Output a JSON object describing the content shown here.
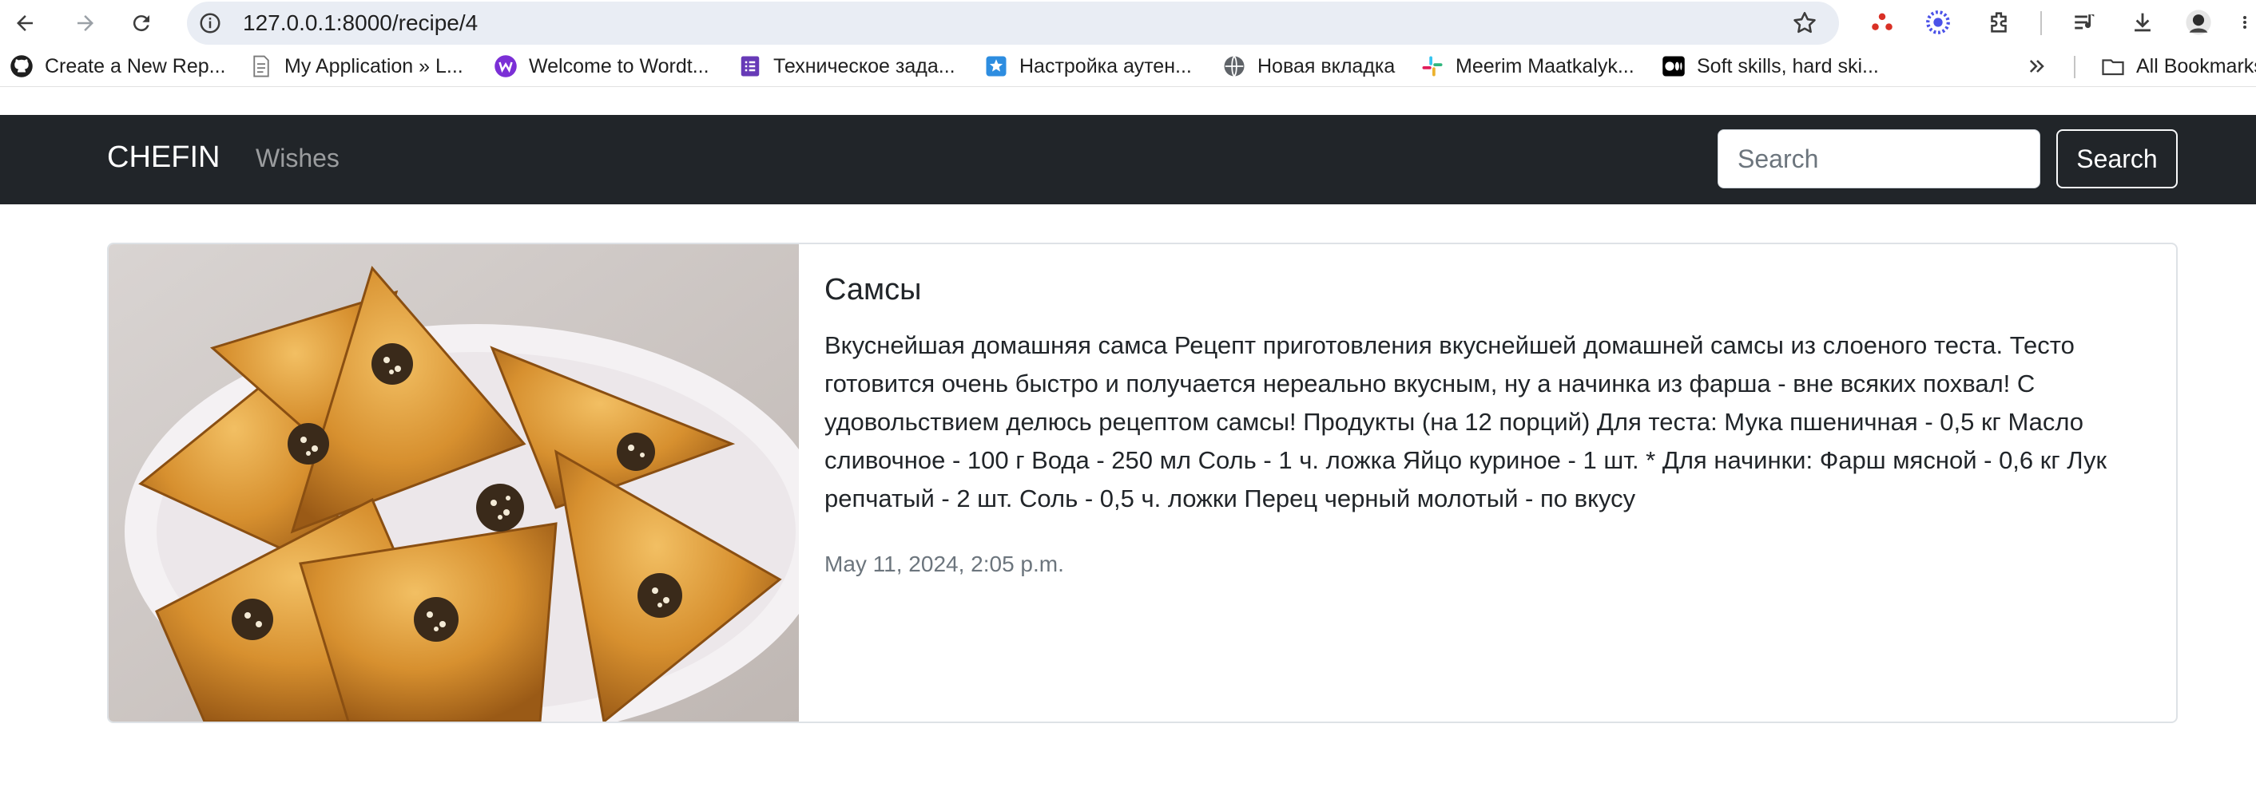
{
  "browser": {
    "url": "127.0.0.1:8000/recipe/4",
    "bookmarks": [
      {
        "label": "Create a New Rep...",
        "icon": "github-icon"
      },
      {
        "label": "My Application » L...",
        "icon": "document-icon"
      },
      {
        "label": "Welcome to Wordt...",
        "icon": "wordtune-icon"
      },
      {
        "label": "Техническое зада...",
        "icon": "forms-icon"
      },
      {
        "label": "Настройка аутен...",
        "icon": "app-icon"
      },
      {
        "label": "Новая вкладка",
        "icon": "globe-icon"
      },
      {
        "label": "Meerim Maatkalyk...",
        "icon": "slack-icon"
      },
      {
        "label": "Soft skills, hard ski...",
        "icon": "medium-icon"
      }
    ],
    "all_bookmarks": "All Bookmarks"
  },
  "navbar": {
    "brand": "CHEFIN",
    "link": "Wishes",
    "search_placeholder": "Search",
    "search_button": "Search"
  },
  "recipe": {
    "title": "Самсы",
    "description": "Вкуснейшая домашняя самса Рецепт приготовления вкуснейшей домашней самсы из слоеного теста. Тесто готовится очень быстро и получается нереально вкусным, ну а начинка из фарша - вне всяких похвал! С удовольствием делюсь рецептом самсы! Продукты (на 12 порций) Для теста: Мука пшеничная - 0,5 кг Масло сливочное - 100 г Вода - 250 мл Соль - 1 ч. ложка Яйцо куриное - 1 шт. * Для начинки: Фарш мясной - 0,6 кг Лук репчатый - 2 шт. Соль - 0,5 ч. ложки Перец черный молотый - по вкусу",
    "date": "May 11, 2024, 2:05 p.m.",
    "image": "samsa-photo"
  },
  "colors": {
    "navbar_bg": "#212529",
    "card_border": "#dee2e6",
    "muted_text": "#6c757d"
  }
}
